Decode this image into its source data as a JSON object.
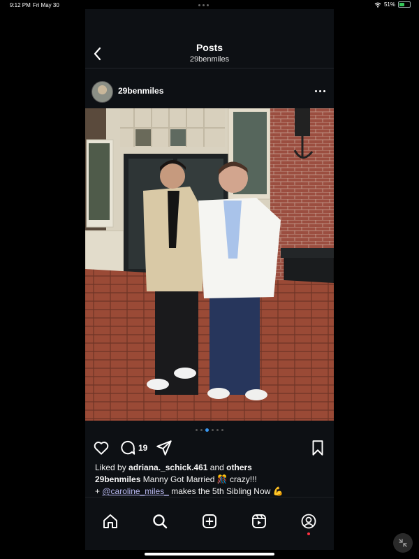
{
  "status_bar": {
    "time": "9:12 PM",
    "date": "Fri May 30",
    "battery": "51%",
    "battery_level": 0.51
  },
  "header": {
    "title": "Posts",
    "subtitle": "29benmiles"
  },
  "post": {
    "username": "29benmiles",
    "carousel": {
      "count": 6,
      "active_index": 2
    },
    "comment_count": "19",
    "likes": {
      "prefix": "Liked by ",
      "user": "adriana._schick.461",
      "middle": " and ",
      "others": "others"
    },
    "caption": {
      "username": "29benmiles",
      "text": " Manny Got Married 🎊 crazy!!!",
      "line2_prefix": "+ ",
      "mention": "@caroline_miles_",
      "line2_text": " makes the 5th Sibling Now 💪"
    }
  },
  "tabbar": [
    "home-icon",
    "search-icon",
    "create-icon",
    "reels-icon",
    "profile-icon"
  ],
  "colors": {
    "background": "#0d1014",
    "accent": "#3897f0",
    "notification": "#ff3040"
  }
}
